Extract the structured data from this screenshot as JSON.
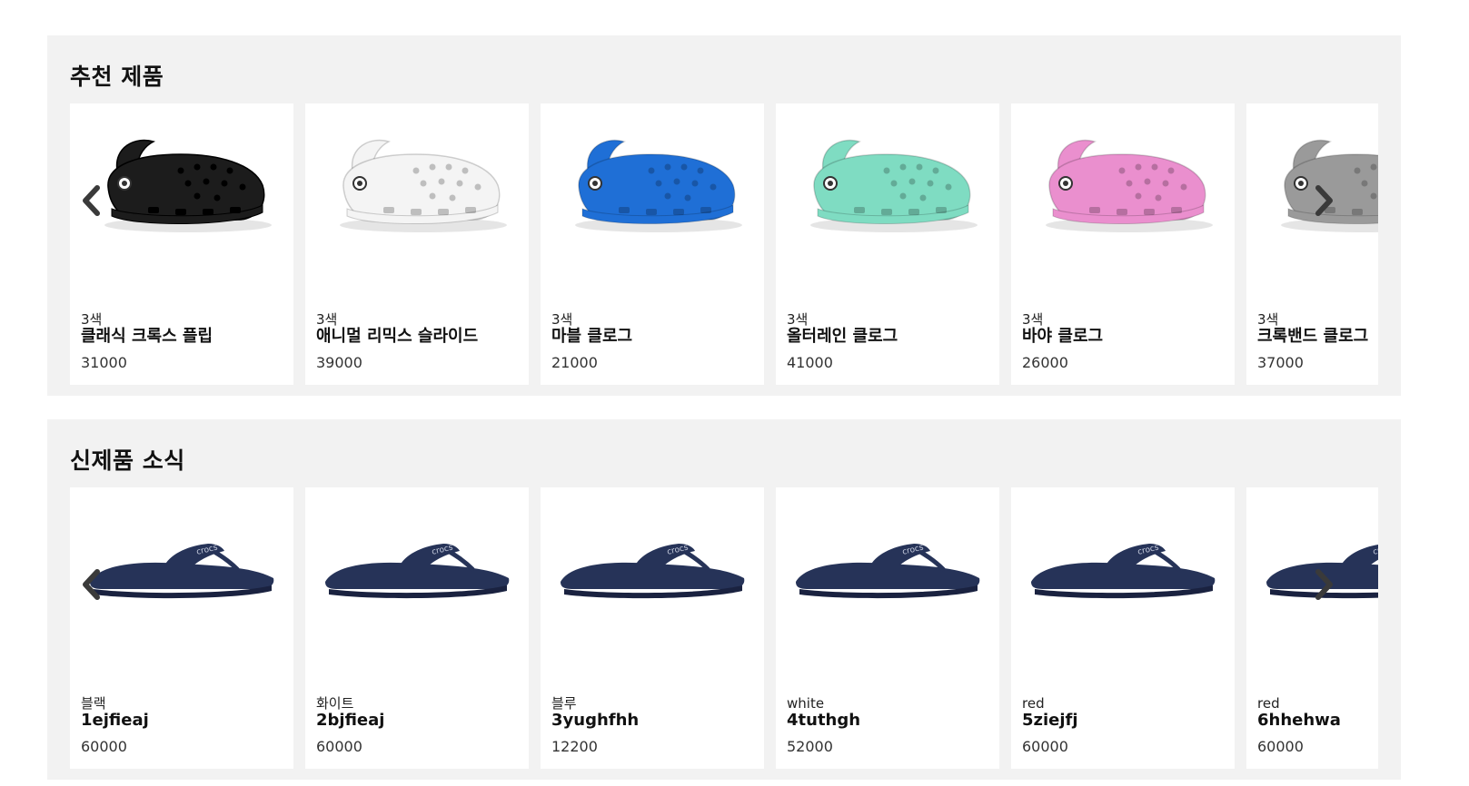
{
  "sections": {
    "recommended": {
      "title": "추천 제품",
      "products": [
        {
          "sub": "3색",
          "name": "클래식 크록스 플립",
          "price": "31000",
          "color": "#1c1c1c"
        },
        {
          "sub": "3색",
          "name": "애니멀 리믹스 슬라이드",
          "price": "39000",
          "color": "#f4f4f4"
        },
        {
          "sub": "3색",
          "name": "마블 클로그",
          "price": "21000",
          "color": "#1f6fd6"
        },
        {
          "sub": "3색",
          "name": "올터레인 클로그",
          "price": "41000",
          "color": "#7fdcc2"
        },
        {
          "sub": "3색",
          "name": "바야 클로그",
          "price": "26000",
          "color": "#ea8fce"
        },
        {
          "sub": "3색",
          "name": "크록밴드 클로그",
          "price": "37000",
          "color": "#9a9a9a"
        }
      ]
    },
    "new_arrivals": {
      "title": "신제품 소식",
      "products": [
        {
          "sub": "블랙",
          "name": "1ejfieaj",
          "price": "60000",
          "color": "#263358"
        },
        {
          "sub": "화이트",
          "name": "2bjfieaj",
          "price": "60000",
          "color": "#263358"
        },
        {
          "sub": "블루",
          "name": "3yughfhh",
          "price": "12200",
          "color": "#263358"
        },
        {
          "sub": "white",
          "name": "4tuthgh",
          "price": "52000",
          "color": "#263358"
        },
        {
          "sub": "red",
          "name": "5ziejfj",
          "price": "60000",
          "color": "#263358"
        },
        {
          "sub": "red",
          "name": "6hhehwa",
          "price": "60000",
          "color": "#263358"
        }
      ]
    }
  },
  "icons": {
    "prev": "chevron-left-icon",
    "next": "chevron-right-icon"
  }
}
